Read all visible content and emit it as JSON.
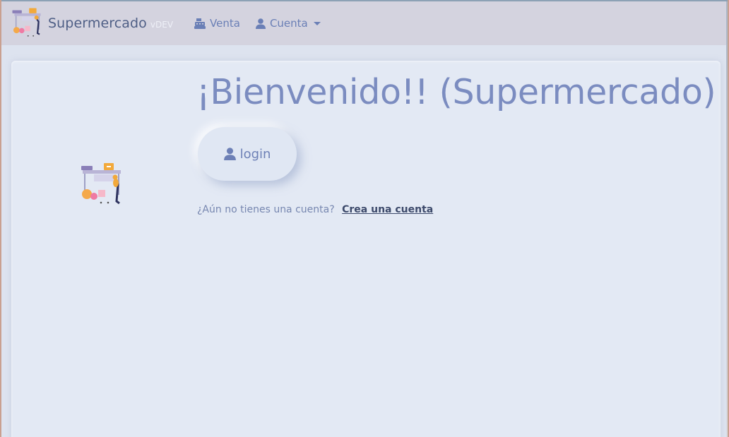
{
  "navbar": {
    "brand_name": "Supermercado",
    "brand_version": "vDEV",
    "items": [
      {
        "label": "Venta",
        "icon": "cash-register-icon"
      },
      {
        "label": "Cuenta",
        "icon": "user-icon",
        "dropdown": true
      }
    ]
  },
  "main": {
    "welcome_title": "¡Bienvenido!! (Supermercado)",
    "login_button": "login",
    "signup_prompt": "¿Aún no tienes una cuenta?",
    "signup_link": "Crea una cuenta"
  },
  "colors": {
    "accent": "#7b8cc0",
    "navbar_bg": "#d4d3df",
    "page_bg": "#e3e9f4",
    "link": "#3d4a6b"
  }
}
